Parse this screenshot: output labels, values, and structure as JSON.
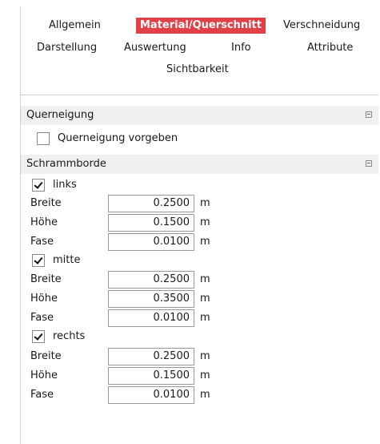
{
  "tabs": [
    {
      "label": "Allgemein",
      "active": false
    },
    {
      "label": "Material/Querschnitt",
      "active": true
    },
    {
      "label": "Verschneidung",
      "active": false
    },
    {
      "label": "Darstellung",
      "active": false
    },
    {
      "label": "Auswertung",
      "active": false
    },
    {
      "label": "Info",
      "active": false
    },
    {
      "label": "Attribute",
      "active": false
    },
    {
      "label": "Sichtbarkeit",
      "active": false
    }
  ],
  "querneigung": {
    "header": "Querneigung",
    "checkbox_label": "Querneigung vorgeben",
    "checked": false
  },
  "schrammborde": {
    "header": "Schrammborde",
    "groups": [
      {
        "label": "links",
        "checked": true,
        "fields": [
          {
            "label": "Breite",
            "value": "0.2500",
            "unit": "m"
          },
          {
            "label": "Höhe",
            "value": "0.1500",
            "unit": "m"
          },
          {
            "label": "Fase",
            "value": "0.0100",
            "unit": "m"
          }
        ]
      },
      {
        "label": "mitte",
        "checked": true,
        "fields": [
          {
            "label": "Breite",
            "value": "0.2500",
            "unit": "m"
          },
          {
            "label": "Höhe",
            "value": "0.3500",
            "unit": "m"
          },
          {
            "label": "Fase",
            "value": "0.0100",
            "unit": "m"
          }
        ]
      },
      {
        "label": "rechts",
        "checked": true,
        "fields": [
          {
            "label": "Breite",
            "value": "0.2500",
            "unit": "m"
          },
          {
            "label": "Höhe",
            "value": "0.1500",
            "unit": "m"
          },
          {
            "label": "Fase",
            "value": "0.0100",
            "unit": "m"
          }
        ]
      }
    ]
  },
  "colors": {
    "accent": "#e04046",
    "section_bg": "#f0f0f0"
  }
}
